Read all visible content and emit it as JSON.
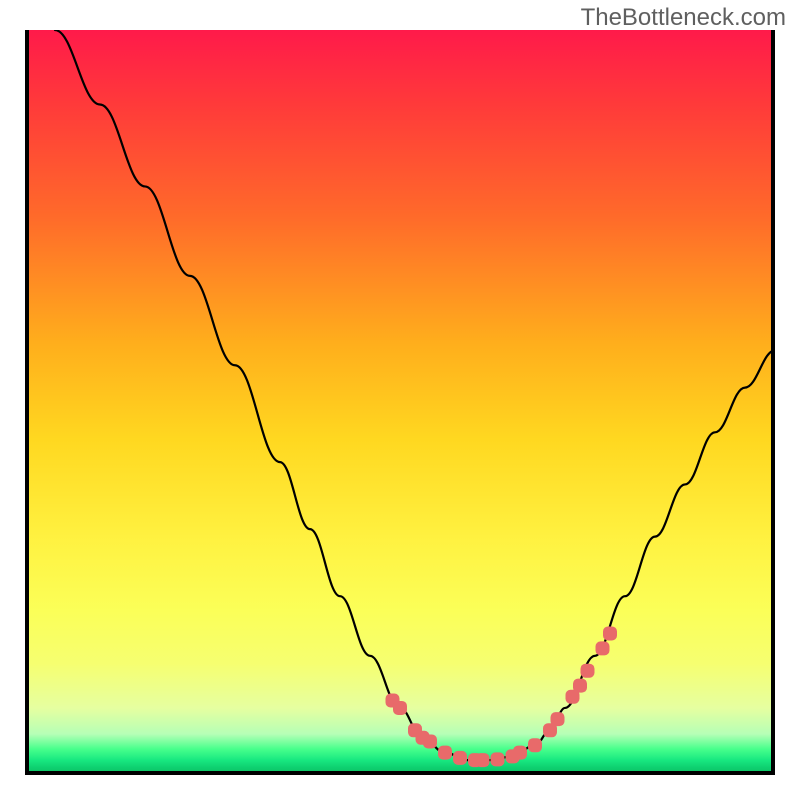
{
  "watermark": {
    "text": "TheBottleneck.com"
  },
  "colors": {
    "curve": "#000000",
    "marker_fill": "#e86a6a",
    "marker_stroke": "#c74a4a",
    "gradient_top": "#ff1a4a",
    "gradient_bottom": "#0ac25e"
  },
  "chart_data": {
    "type": "line",
    "title": "",
    "xlabel": "",
    "ylabel": "",
    "xlim": [
      0,
      100
    ],
    "ylim": [
      0,
      100
    ],
    "grid": false,
    "legend": false,
    "series": [
      {
        "name": "curve",
        "x": [
          4,
          10,
          16,
          22,
          28,
          34,
          38,
          42,
          46,
          50,
          53,
          56,
          59,
          62,
          65,
          68,
          70,
          72,
          76,
          80,
          84,
          88,
          92,
          96,
          100
        ],
        "y": [
          100,
          90,
          79,
          67,
          55,
          42,
          33,
          24,
          16,
          9,
          5,
          3,
          2,
          2,
          2.5,
          4,
          6,
          9,
          16,
          24,
          32,
          39,
          46,
          52,
          57
        ]
      }
    ],
    "markers": {
      "name": "highlight",
      "color": "#e86a6a",
      "x": [
        49,
        50,
        52,
        53,
        54,
        56,
        58,
        60,
        61,
        63,
        65,
        66,
        68,
        70,
        71,
        73,
        74,
        75,
        77,
        78
      ],
      "y": [
        10,
        9,
        6,
        5,
        4.5,
        3,
        2.3,
        2,
        2,
        2.1,
        2.5,
        3,
        4,
        6,
        7.5,
        10.5,
        12,
        14,
        17,
        19
      ]
    }
  }
}
